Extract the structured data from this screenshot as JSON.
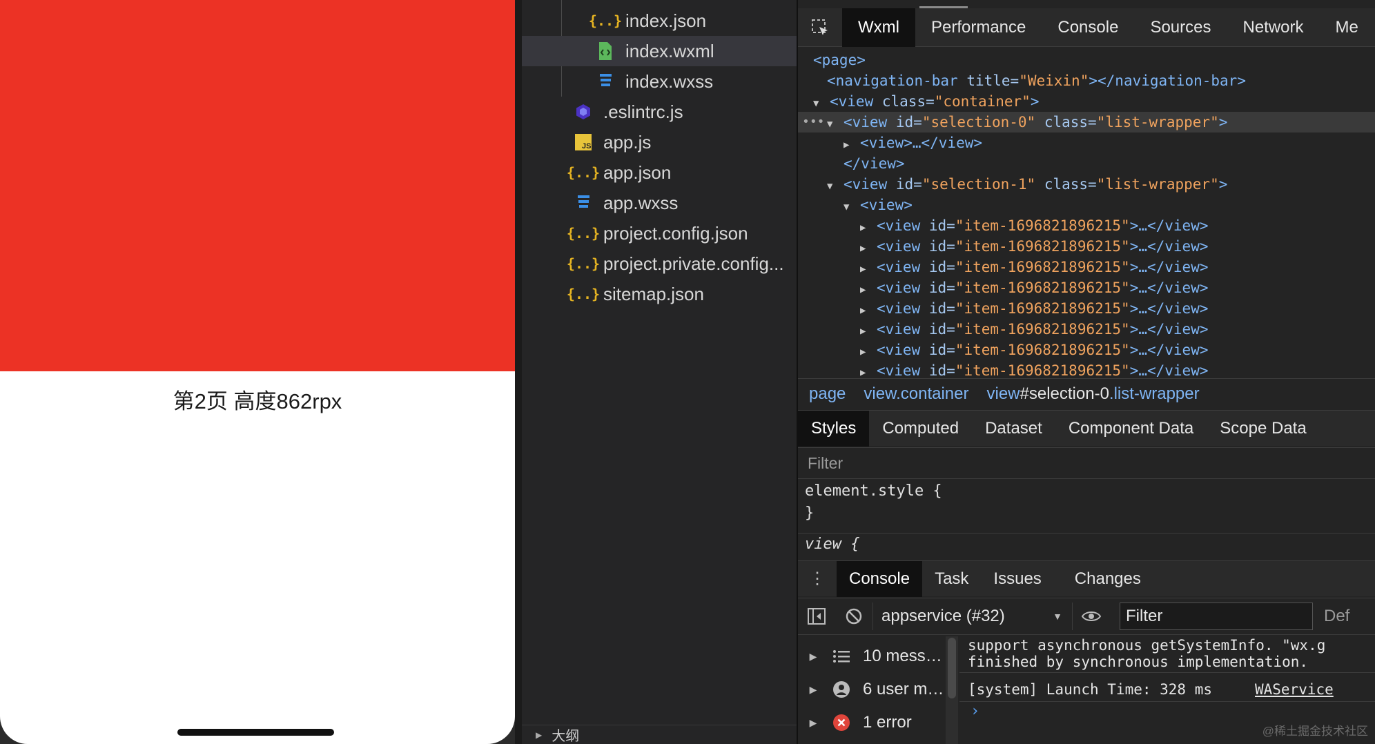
{
  "simulator": {
    "page_label": "第2页 高度862rpx",
    "red_color": "#ec3225"
  },
  "file_tree": {
    "items": [
      {
        "name": "index.json",
        "icon": "json-icon"
      },
      {
        "name": "index.wxml",
        "icon": "wxml-icon",
        "selected": true
      },
      {
        "name": "index.wxss",
        "icon": "wxss-icon"
      },
      {
        "name": ".eslintrc.js",
        "icon": "eslint-icon"
      },
      {
        "name": "app.js",
        "icon": "js-icon"
      },
      {
        "name": "app.json",
        "icon": "json-icon"
      },
      {
        "name": "app.wxss",
        "icon": "wxss-icon"
      },
      {
        "name": "project.config.json",
        "icon": "json-icon"
      },
      {
        "name": "project.private.config...",
        "icon": "json-icon"
      },
      {
        "name": "sitemap.json",
        "icon": "json-icon"
      }
    ],
    "json_glyph": "{..}",
    "outline_label": "大纲"
  },
  "devtools": {
    "tabs": [
      "Wxml",
      "Performance",
      "Console",
      "Sources",
      "Network",
      "Me"
    ],
    "active_tab": "Wxml",
    "dom": {
      "page_open": "<page>",
      "nav_tag": "navigation-bar",
      "nav_attr": "title",
      "nav_value": "\"Weixin\"",
      "container_class": "\"container\"",
      "sel0_id": "\"selection-0\"",
      "sel1_id": "\"selection-1\"",
      "list_class": "\"list-wrapper\"",
      "collapsed_view": "<view>…</view>",
      "close_view": "</view>",
      "open_view": "<view>",
      "item_id": "\"item-1696821896215\"",
      "item_count": 8
    },
    "breadcrumbs": [
      {
        "label": "page"
      },
      {
        "label": "view.container"
      },
      {
        "prefix": "view",
        "strong": "#selection-0",
        "suffix": ".list-wrapper"
      }
    ],
    "subtabs": [
      "Styles",
      "Computed",
      "Dataset",
      "Component Data",
      "Scope Data"
    ],
    "active_subtab": "Styles",
    "filter_placeholder": "Filter",
    "styles": {
      "element_style_open": "element.style {",
      "element_style_close": "}",
      "view_rule": "view {"
    },
    "drawer_tabs": [
      "Console",
      "Task",
      "Issues",
      "Changes"
    ],
    "active_drawer_tab": "Console",
    "console": {
      "context": "appservice (#32)",
      "filter_value": "Filter",
      "default_levels": "Def",
      "sidebar": [
        {
          "label": "10 mess…",
          "icon": "list-icon"
        },
        {
          "label": "6 user m…",
          "icon": "user-icon"
        },
        {
          "label": "1 error",
          "icon": "error-icon"
        }
      ],
      "lines": [
        "support asynchronous getSystemInfo. \"wx.g",
        "finished by synchronous implementation.",
        "[system] Launch Time: 328 ms"
      ],
      "link": "WAService",
      "prompt": "›"
    },
    "watermark": "@稀土掘金技术社区"
  }
}
